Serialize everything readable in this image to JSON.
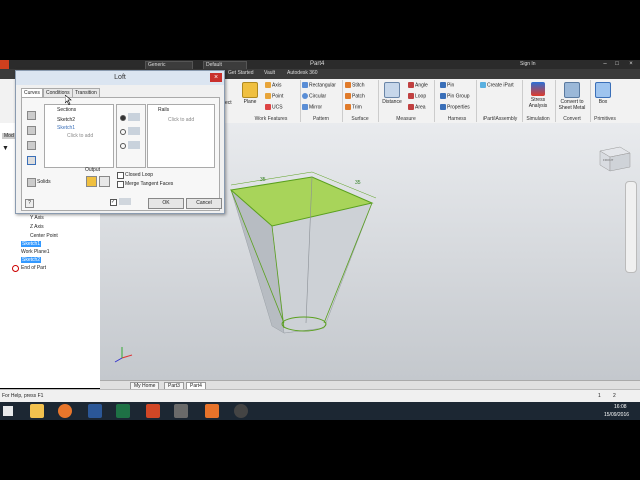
{
  "window": {
    "title": "Part4",
    "material_select": "Generic",
    "appearance_select": "Default",
    "sign_in": "Sign In"
  },
  "ribbon_tabs": [
    "Get Started",
    "Vault",
    "Autodesk 360"
  ],
  "ribbon": {
    "plane": "Plane",
    "axis": "Axis",
    "point": "Point",
    "ucs": "UCS",
    "work_features": "Work Features",
    "rectangular": "Rectangular",
    "circular": "Circular",
    "mirror": "Mirror",
    "pattern": "Pattern",
    "stitch": "Stitch",
    "patch": "Patch",
    "trim": "Trim",
    "surface": "Surface",
    "distance": "Distance",
    "angle": "Angle",
    "loop": "Loop",
    "area": "Area",
    "measure": "Measure",
    "pin": "Pin",
    "pin_group": "Pin Group",
    "properties": "Properties",
    "harness": "Harness",
    "create_ipart": "Create iPart",
    "ipart_assembly": "iPart/iAssembly",
    "stress_analysis": "Stress Analysis",
    "simulation": "Simulation",
    "convert_sheet": "Convert to Sheet Metal",
    "convert": "Convert",
    "box": "Box",
    "primitives": "Primitives",
    "ect": "ect"
  },
  "browser": {
    "items": [
      "Y Axis",
      "Z Axis",
      "Center Point",
      "Sketch1",
      "Work Plane1",
      "Sketch2",
      "End of Part"
    ],
    "mod_tab": "Mod"
  },
  "dialog": {
    "title": "Loft",
    "tabs": [
      "Curves",
      "Conditions",
      "Transition"
    ],
    "sections_label": "Sections",
    "sections": [
      "Sketch2",
      "Sketch1"
    ],
    "click_to_add": "Click to add",
    "rails_label": "Rails",
    "rails_click": "Click to add",
    "solids": "Solids",
    "output": "Output",
    "closed_loop": "Closed Loop",
    "merge_tangent": "Merge Tangent Faces",
    "ok": "OK",
    "cancel": "Cancel"
  },
  "canvas": {
    "dim_left": "35",
    "dim_right": "35",
    "viewcube": "FRONT"
  },
  "doc_tabs": [
    "My Home",
    "Part3",
    "Part4"
  ],
  "status": {
    "help": "For Help, press F1",
    "num1": "1",
    "num2": "2"
  },
  "taskbar": {
    "time": "16:08",
    "date": "15/09/2016"
  },
  "colors": {
    "accent_green": "#9ccc3a",
    "selection_blue": "#3399ff",
    "taskbar": "#1c2733"
  }
}
